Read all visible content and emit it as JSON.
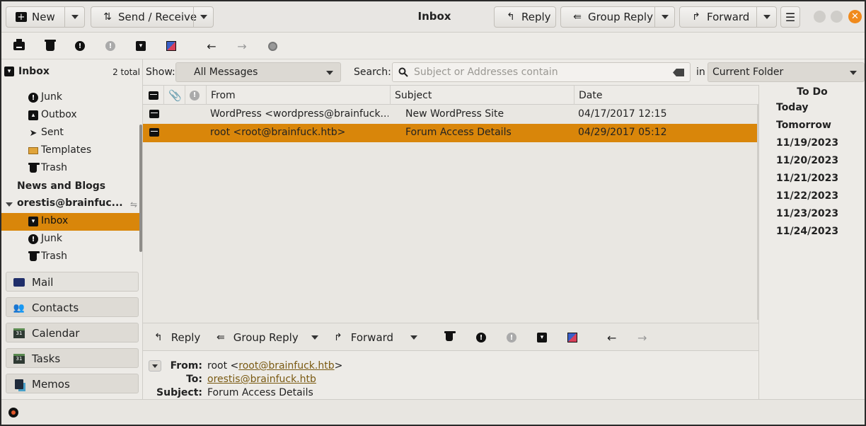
{
  "window": {
    "title": "Inbox"
  },
  "headerbar": {
    "new_label": "New",
    "send_receive_label": "Send / Receive",
    "reply_label": "Reply",
    "group_reply_label": "Group Reply",
    "forward_label": "Forward"
  },
  "sidebar": {
    "header": {
      "name": "Inbox",
      "count": "2 total"
    },
    "folders": [
      {
        "label": "Junk",
        "icon": "junk-icon"
      },
      {
        "label": "Outbox",
        "icon": "outbox-icon"
      },
      {
        "label": "Sent",
        "icon": "sent-icon"
      },
      {
        "label": "Templates",
        "icon": "templates-icon"
      },
      {
        "label": "Trash",
        "icon": "trash-icon"
      }
    ],
    "group_news": "News and Blogs",
    "account": "orestis@brainfuc...",
    "account_folders": [
      {
        "label": "Inbox",
        "icon": "inbox-icon",
        "selected": true
      },
      {
        "label": "Junk",
        "icon": "junk-icon"
      },
      {
        "label": "Trash",
        "icon": "trash-icon"
      }
    ],
    "switcher": [
      {
        "label": "Mail",
        "icon": "mail-icon"
      },
      {
        "label": "Contacts",
        "icon": "contacts-icon"
      },
      {
        "label": "Calendar",
        "icon": "calendar-icon"
      },
      {
        "label": "Tasks",
        "icon": "tasks-icon"
      },
      {
        "label": "Memos",
        "icon": "memos-icon"
      }
    ]
  },
  "filter": {
    "show_label": "Show:",
    "show_value": "All Messages",
    "search_label": "Search:",
    "search_placeholder": "Subject or Addresses contain",
    "in_label": "in",
    "scope_value": "Current Folder"
  },
  "message_list": {
    "columns": {
      "from": "From",
      "subject": "Subject",
      "date": "Date"
    },
    "rows": [
      {
        "from": "WordPress <wordpress@brainfuck....",
        "subject": "New WordPress Site",
        "date": "04/17/2017 12:15",
        "selected": false
      },
      {
        "from": "root <root@brainfuck.htb>",
        "subject": "Forum Access Details",
        "date": "04/29/2017 05:12",
        "selected": true
      }
    ]
  },
  "reading_toolbar": {
    "reply_label": "Reply",
    "group_reply_label": "Group Reply",
    "forward_label": "Forward"
  },
  "preview": {
    "from_label": "From:",
    "from_name": "root <",
    "from_email": "root@brainfuck.htb",
    "from_close": ">",
    "to_label": "To:",
    "to_email": "orestis@brainfuck.htb",
    "subject_label": "Subject:",
    "subject_value": "Forum Access Details"
  },
  "todo": {
    "title": "To Do",
    "items": [
      "Today",
      "Tomorrow",
      "11/19/2023",
      "11/20/2023",
      "11/21/2023",
      "11/22/2023",
      "11/23/2023",
      "11/24/2023"
    ]
  },
  "colors": {
    "accent": "#d9860a",
    "close_button": "#f08a1c",
    "link": "#7a5a12"
  }
}
